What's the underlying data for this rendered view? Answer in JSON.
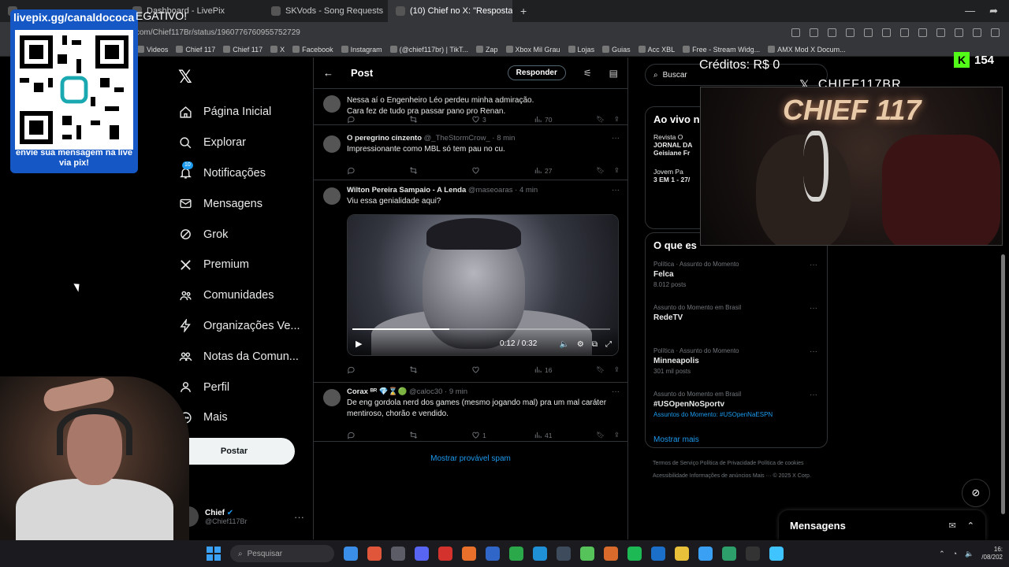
{
  "browser": {
    "tabs": [
      {
        "label": "",
        "active": false
      },
      {
        "label": "",
        "active": false
      },
      {
        "label": "Dashboard - LivePix",
        "active": false
      },
      {
        "label": "SKVods - Song Requests",
        "active": false
      },
      {
        "label": "(10) Chief no X: \"Resposta ao @",
        "active": true
      }
    ],
    "url": "com/Chief117Br/status/1960776760955752729",
    "bookmarks": [
      "Videos",
      "Chief 117",
      "Chief 117",
      "X",
      "Facebook",
      "Instagram",
      "(@chief117br) | TikT...",
      "Zap",
      "Xbox Mil Grau",
      "Lojas",
      "Guias",
      "Acc XBL",
      "Free - Stream Widg...",
      "AMX Mod X Docum..."
    ]
  },
  "overlay": {
    "qr_top": "livepix.gg/canaldococa",
    "qr_bottom": "envie sua mensagem na live via pix!",
    "negativo": "EGATIVO!",
    "creditos": "Créditos: R$ 0",
    "kick_count": "154",
    "cam_label": "CHIEF117BR",
    "cam_sign": "CHIEF 117"
  },
  "nav": {
    "items": [
      {
        "label": "Página Inicial",
        "icon": "home"
      },
      {
        "label": "Explorar",
        "icon": "search"
      },
      {
        "label": "Notificações",
        "icon": "bell",
        "badge": "10"
      },
      {
        "label": "Mensagens",
        "icon": "mail"
      },
      {
        "label": "Grok",
        "icon": "grok"
      },
      {
        "label": "Premium",
        "icon": "x"
      },
      {
        "label": "Comunidades",
        "icon": "people"
      },
      {
        "label": "Organizações Ve...",
        "icon": "bolt"
      },
      {
        "label": "Notas da Comun...",
        "icon": "notes"
      },
      {
        "label": "Perfil",
        "icon": "person"
      },
      {
        "label": "Mais",
        "icon": "more"
      }
    ],
    "post_button": "Postar",
    "profile_name": "Chief",
    "profile_handle": "@Chief117Br"
  },
  "feed": {
    "header_title": "Post",
    "reply_button": "Responder",
    "tweets": [
      {
        "name": "",
        "handle": "",
        "time": "",
        "text": "Nessa aí o Engenheiro Léo perdeu minha admiração.\nCara fez de tudo pra passar pano pro Renan.",
        "likes": "3",
        "views": "70"
      },
      {
        "name": "O peregrino cinzento",
        "handle": "@_TheStormCrow_",
        "time": "· 8 min",
        "text": "Impressionante como MBL só tem pau no cu.",
        "likes": "",
        "views": "27"
      },
      {
        "name": "Wilton Pereira Sampaio - A Lenda",
        "handle": "@maseoaras",
        "time": "· 4 min",
        "text": "Viu essa genialidade aqui?",
        "likes": "",
        "views": "16",
        "video_time": "0:12 / 0:32",
        "video_progress": 0.375
      },
      {
        "name": "Corax ᴮᴿ 💎⌛🟢",
        "handle": "@caloc30",
        "time": "· 9 min",
        "text": "De eng gordola nerd dos games (mesmo jogando mal) pra um mal caráter mentiroso, chorão e vendido.",
        "likes": "1",
        "views": "41"
      }
    ],
    "spam_link": "Mostrar provável spam"
  },
  "sidebar_right": {
    "search_placeholder": "Buscar",
    "live_title": "Ao vivo n",
    "live_items": [
      {
        "a": "Revista O",
        "b": "JORNAL DA",
        "c": "Geisiane Fr"
      },
      {
        "a": "Jovem Pa",
        "b": "3 EM 1 - 27/",
        "c": ""
      }
    ],
    "trends_title": "O que es",
    "trends": [
      {
        "category": "Política · Assunto do Momento",
        "name": "Felca",
        "count": "8.012 posts"
      },
      {
        "category": "Assunto do Momento em Brasil",
        "name": "RedeTV",
        "count": ""
      },
      {
        "category": "Política · Assunto do Momento",
        "name": "Minneapolis",
        "count": "301 mil posts"
      },
      {
        "category": "Assunto do Momento em Brasil",
        "name": "#USOpenNoSportv",
        "count": "Assuntos do Momento: #USOpenNaESPN"
      }
    ],
    "show_more": "Mostrar mais",
    "footer": [
      "Termos de Serviço",
      "Política de Privacidade",
      "Política de cookies",
      "Acessibilidade",
      "Informações de anúncios",
      "Mais ···",
      "© 2025 X Corp."
    ]
  },
  "messages_bar": "Mensagens",
  "taskbar": {
    "search": "Pesquisar",
    "time": "16:",
    "date": "/08/202"
  }
}
